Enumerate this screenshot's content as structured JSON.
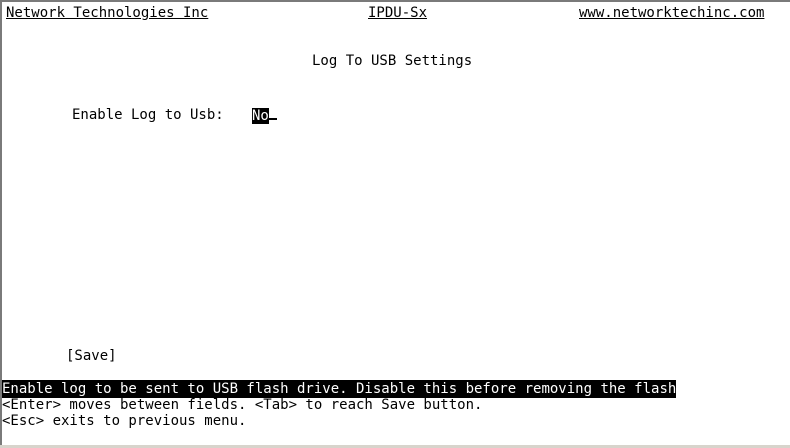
{
  "header": {
    "company": "Network Technologies Inc",
    "product": "IPDU-Sx",
    "website": "www.networktechinc.com"
  },
  "page": {
    "title": "Log To USB Settings"
  },
  "fields": {
    "enable_log_label": "Enable Log to Usb:",
    "enable_log_value": "No"
  },
  "actions": {
    "save_label": "[Save]"
  },
  "footer": {
    "help_line": "Enable log to be sent to USB flash drive. Disable this before removing the flash",
    "nav_hint": "<Enter> moves between fields. <Tab> to reach Save button.",
    "esc_hint": "<Esc> exits to previous menu."
  }
}
